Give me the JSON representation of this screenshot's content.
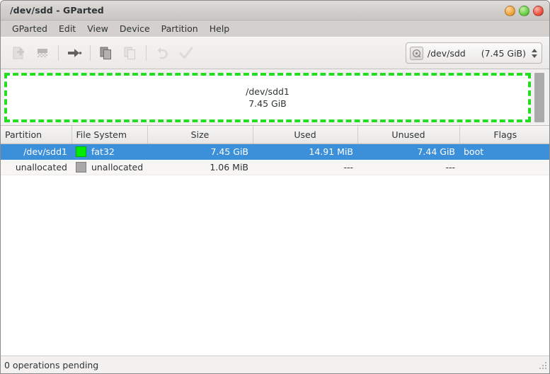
{
  "window": {
    "title": "/dev/sdd - GParted",
    "buttons": [
      {
        "name": "minimize-button",
        "label": "Minimize",
        "color": "#f0a33c"
      },
      {
        "name": "maximize-button",
        "label": "Maximize",
        "color": "#6bcf46"
      },
      {
        "name": "close-button",
        "label": "Close",
        "color": "#e8553f"
      }
    ]
  },
  "menubar": {
    "items": [
      {
        "label": "GParted"
      },
      {
        "label": "Edit"
      },
      {
        "label": "View"
      },
      {
        "label": "Device"
      },
      {
        "label": "Partition"
      },
      {
        "label": "Help"
      }
    ]
  },
  "toolbar": {
    "buttons": [
      {
        "name": "new-partition-button",
        "icon": "new-partition-icon",
        "label": "New",
        "enabled": false
      },
      {
        "name": "delete-partition-button",
        "icon": "delete-partition-icon",
        "label": "Delete",
        "enabled": false
      },
      {
        "name": "resize-move-button",
        "icon": "resize-move-icon",
        "label": "Resize/Move",
        "enabled": true
      },
      {
        "name": "copy-button",
        "icon": "copy-icon",
        "label": "Copy",
        "enabled": true
      },
      {
        "name": "paste-button",
        "icon": "paste-icon",
        "label": "Paste",
        "enabled": false
      },
      {
        "name": "undo-button",
        "icon": "undo-icon",
        "label": "Undo",
        "enabled": false
      },
      {
        "name": "apply-button",
        "icon": "apply-checkmark-icon",
        "label": "Apply All Operations",
        "enabled": false
      }
    ],
    "device_selector": {
      "icon": "hard-disk-icon",
      "device": "/dev/sdd",
      "size": "(7.45 GiB)"
    }
  },
  "graphic": {
    "partition_name": "/dev/sdd1",
    "partition_size": "7.45 GiB",
    "selection_color": "#22dd22",
    "fill_color": "#ffffff"
  },
  "table": {
    "headers": [
      "Partition",
      "File System",
      "Size",
      "Used",
      "Unused",
      "Flags"
    ],
    "rows": [
      {
        "partition": "/dev/sdd1",
        "filesystem": "fat32",
        "swatch_color": "#00ea00",
        "size": "7.45 GiB",
        "used": "14.91 MiB",
        "unused": "7.44 GiB",
        "flags": "boot",
        "selected": true
      },
      {
        "partition": "unallocated",
        "filesystem": "unallocated",
        "swatch_color": "#a8a8a8",
        "size": "1.06 MiB",
        "used": "---",
        "unused": "---",
        "flags": "",
        "selected": false
      }
    ]
  },
  "statusbar": {
    "text": "0 operations pending"
  }
}
